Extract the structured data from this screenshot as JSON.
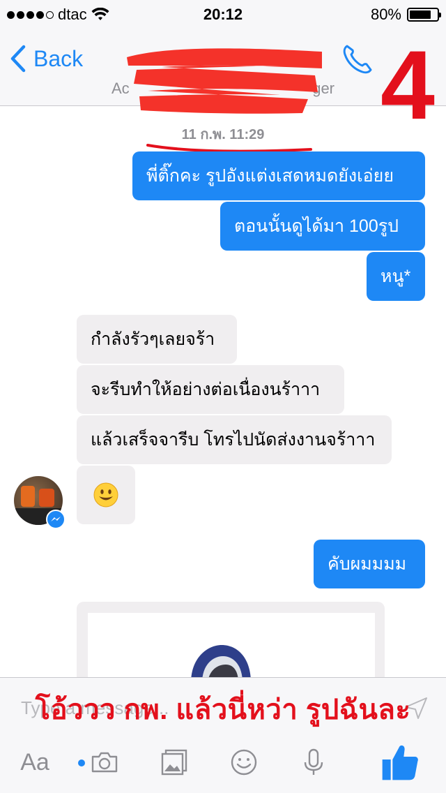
{
  "status_bar": {
    "carrier": "dtac",
    "time": "20:12",
    "battery": "80%",
    "battery_level": 0.8
  },
  "nav": {
    "back_label": "Back",
    "subtitle_left": "Ac",
    "subtitle_right": "ger",
    "overlay_number": "4"
  },
  "chat": {
    "timestamp": "11 ก.พ. 11:29",
    "messages_out_1": [
      "พี่ติ๊กคะ รูปอังแต่งเสดหมดยังเอ่ยย",
      "ตอนนั้นดูได้มา 100รูป",
      "หนู*"
    ],
    "messages_in": [
      "กำลังรัวๆเลยจร้า",
      "จะรีบทำให้อย่างต่อเนื่องนร้าาา",
      "แล้วเสร็จจารีบ โทรไปนัดส่งงานจร้าาา"
    ],
    "emoji_message": "smiley-emoji",
    "messages_out_2": [
      "คับผมมมม"
    ]
  },
  "composer": {
    "placeholder": "Type a message...",
    "overlay_caption": "โอ้ววว กพ. แล้วนี่หว่า รูปฉันละ",
    "aa_label": "Aa"
  },
  "colors": {
    "accent": "#1e88f5",
    "incoming_bubble": "#f0eef0",
    "overlay_red": "#e3101c"
  },
  "icons": [
    "wifi-icon",
    "chevron-left-icon",
    "phone-icon",
    "camera-icon",
    "gallery-icon",
    "emoji-icon",
    "microphone-icon",
    "thumbs-up-icon",
    "send-icon",
    "messenger-icon"
  ]
}
